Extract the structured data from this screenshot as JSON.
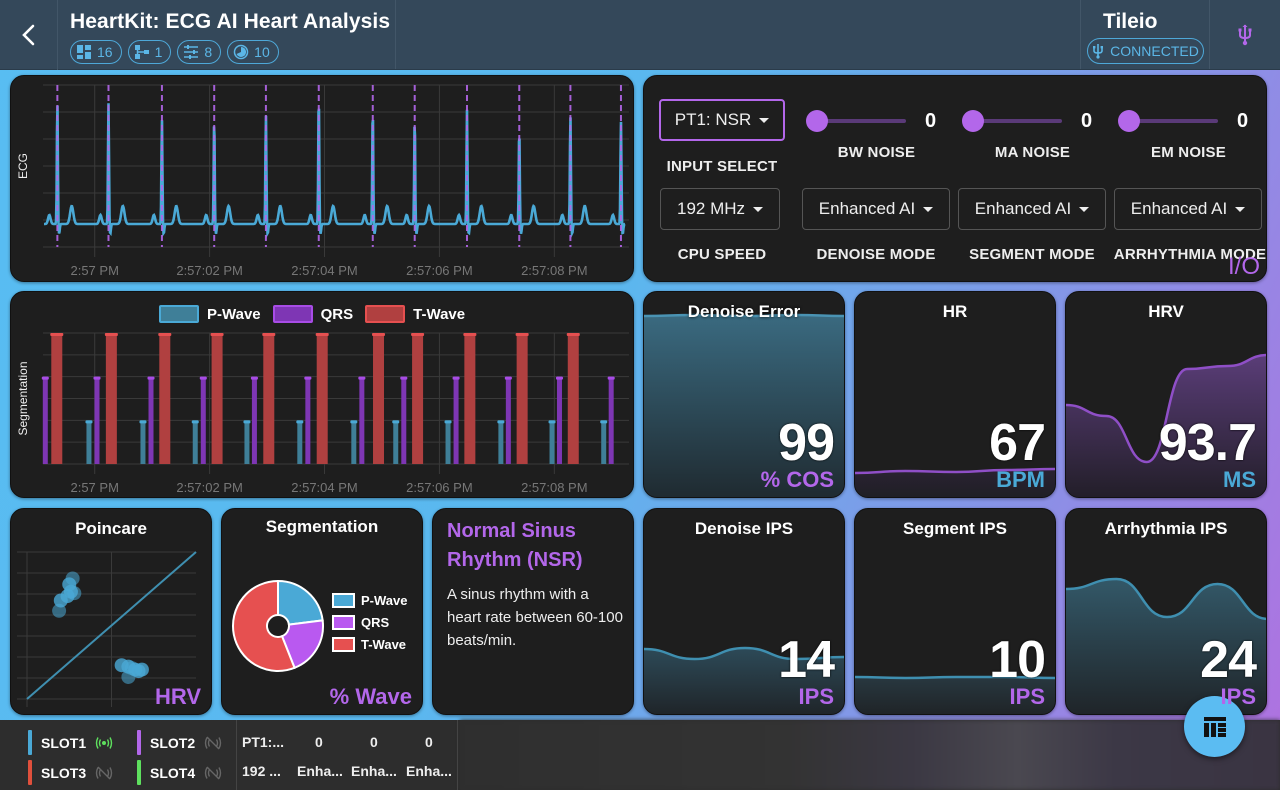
{
  "header": {
    "title": "HeartKit: ECG AI Heart Analysis",
    "back_icon": "chevron-left-icon",
    "chips": [
      {
        "icon": "dashboard-icon",
        "value": "16"
      },
      {
        "icon": "hierarchy-icon",
        "value": "1"
      },
      {
        "icon": "sliders-icon",
        "value": "8"
      },
      {
        "icon": "pie-timer-icon",
        "value": "10"
      }
    ],
    "device_name": "Tileio",
    "connection_status": "CONNECTED",
    "usb_icon": "usb-icon"
  },
  "ecg_chart": {
    "ylabel": "ECG",
    "x_ticks": [
      "2:57 PM",
      "2:57:02 PM",
      "2:57:04 PM",
      "2:57:06 PM",
      "2:57:08 PM"
    ]
  },
  "io": {
    "input_select": {
      "value": "PT1: NSR",
      "label": "INPUT SELECT"
    },
    "cpu_speed": {
      "value": "192 MHz",
      "label": "CPU SPEED"
    },
    "sliders": [
      {
        "label": "BW NOISE",
        "value": "0"
      },
      {
        "label": "MA NOISE",
        "value": "0"
      },
      {
        "label": "EM NOISE",
        "value": "0"
      }
    ],
    "modes": [
      {
        "label": "DENOISE MODE",
        "value": "Enhanced AI"
      },
      {
        "label": "SEGMENT MODE",
        "value": "Enhanced AI"
      },
      {
        "label": "ARRHYTHMIA MODE",
        "value": "Enhanced AI"
      }
    ],
    "tag": "I/O"
  },
  "segmentation_chart": {
    "ylabel": "Segmentation",
    "legend": [
      "P-Wave",
      "QRS",
      "T-Wave"
    ],
    "x_ticks": [
      "2:57 PM",
      "2:57:02 PM",
      "2:57:04 PM",
      "2:57:06 PM",
      "2:57:08 PM"
    ]
  },
  "metrics": [
    {
      "title": "Denoise Error",
      "value": "99",
      "unit": "% COS"
    },
    {
      "title": "HR",
      "value": "67",
      "unit": "BPM"
    },
    {
      "title": "HRV",
      "value": "93.7",
      "unit": "MS"
    },
    {
      "title": "Denoise IPS",
      "value": "14",
      "unit": "IPS"
    },
    {
      "title": "Segment IPS",
      "value": "10",
      "unit": "IPS"
    },
    {
      "title": "Arrhythmia IPS",
      "value": "24",
      "unit": "IPS"
    }
  ],
  "poincare": {
    "title": "Poincare",
    "tag": "HRV"
  },
  "segmentation_pie": {
    "title": "Segmentation",
    "tag": "% Wave",
    "legend": [
      "P-Wave",
      "QRS",
      "T-Wave"
    ],
    "fractions": [
      0.23,
      0.21,
      0.56
    ]
  },
  "rhythm": {
    "title": "Normal Sinus Rhythm (NSR)",
    "description": "A sinus rhythm with a heart rate between 60-100 beats/min."
  },
  "bottom_bar": {
    "slots": [
      {
        "label": "SLOT1",
        "status": "connected"
      },
      {
        "label": "SLOT2",
        "status": "disconnected"
      },
      {
        "label": "SLOT3",
        "status": "disconnected"
      },
      {
        "label": "SLOT4",
        "status": "disconnected"
      }
    ],
    "summary_row1": [
      "PT1:...",
      "0",
      "0",
      "0"
    ],
    "summary_row2": [
      "192 ...",
      "Enha...",
      "Enha...",
      "Enha..."
    ]
  },
  "fab_icon": "dashboard-layout-icon",
  "colors": {
    "blue": "#4aa9d6",
    "purple": "#b367ea",
    "red": "#e65050",
    "green": "#5ee05e"
  },
  "chart_data": [
    {
      "type": "line",
      "title": "ECG",
      "ylabel": "ECG",
      "x_ticks": [
        "2:57 PM",
        "2:57:02 PM",
        "2:57:04 PM",
        "2:57:06 PM",
        "2:57:08 PM"
      ],
      "r_peak_times_s": [
        -0.65,
        0.24,
        1.17,
        2.08,
        2.98,
        3.9,
        4.84,
        5.57,
        6.48,
        7.39,
        8.28,
        9.16
      ],
      "r_peak_amplitudes": [
        0.95,
        0.93,
        0.81,
        0.82,
        0.85,
        1.0,
        0.9,
        0.82,
        0.88,
        0.74,
        0.84,
        0.79
      ]
    },
    {
      "type": "bar",
      "title": "Segmentation",
      "series": [
        {
          "name": "P-Wave",
          "level": 1,
          "times_s": [
            -0.1,
            0.84,
            1.75,
            2.65,
            3.57,
            4.51,
            5.24,
            6.15,
            7.07,
            7.96,
            8.86
          ]
        },
        {
          "name": "QRS",
          "level": 2,
          "times_s": [
            -0.86,
            0.04,
            0.98,
            1.89,
            2.78,
            3.71,
            4.65,
            5.38,
            6.29,
            7.2,
            8.09,
            8.99
          ]
        },
        {
          "name": "T-Wave",
          "level": 3,
          "times_s": [
            -0.66,
            0.29,
            1.22,
            2.13,
            3.03,
            3.96,
            4.94,
            5.62,
            6.53,
            7.44,
            8.33
          ]
        }
      ]
    },
    {
      "type": "scatter",
      "title": "Poincare",
      "points": [
        [
          0.27,
          0.82
        ],
        [
          0.25,
          0.78
        ],
        [
          0.26,
          0.73
        ],
        [
          0.28,
          0.72
        ],
        [
          0.24,
          0.7
        ],
        [
          0.2,
          0.67
        ],
        [
          0.19,
          0.6
        ],
        [
          0.56,
          0.23
        ],
        [
          0.6,
          0.22
        ],
        [
          0.62,
          0.21
        ],
        [
          0.64,
          0.2
        ],
        [
          0.66,
          0.19
        ],
        [
          0.6,
          0.15
        ],
        [
          0.68,
          0.2
        ]
      ]
    },
    {
      "type": "pie",
      "title": "Segmentation",
      "labels": [
        "P-Wave",
        "QRS",
        "T-Wave"
      ],
      "values": [
        23,
        21,
        56
      ]
    }
  ]
}
